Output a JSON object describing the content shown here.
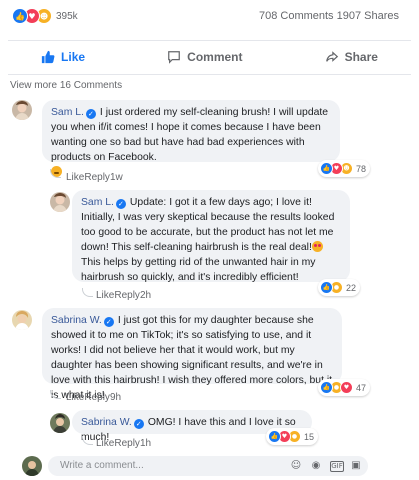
{
  "stats": {
    "reaction_count": "395k",
    "comments_shares": "708 Comments 1907 Shares",
    "reactions": [
      "like-icon",
      "love-icon",
      "haha-icon"
    ]
  },
  "actions": {
    "like": "Like",
    "comment": "Comment",
    "share": "Share"
  },
  "view_more": "View more 16 Comments",
  "comments": [
    {
      "author": "Sam L.",
      "text": "I just ordered my self-cleaning brush! I will update you when if/it comes! I hope it comes because I have been wanting one so bad but have had bad experiences with products on Facebook.",
      "reactions": "78",
      "like": "Like",
      "reply": "Reply",
      "time": "1w"
    },
    {
      "author": "Sam L.",
      "text_a": "Update: I got it a few days ago; I love it! Initially, I was very skeptical because the results looked too good to be accurate, but the product has not let me down! This self-cleaning hairbrush is the real deal!",
      "text_b": " This helps by getting rid of the unwanted hair in my hairbrush so quickly, and it's incredibly efficient!",
      "reactions": "22",
      "like": "Like",
      "reply": "Reply",
      "time": "2h"
    },
    {
      "author": "Sabrina W.",
      "text": "I just got this for my daughter because she showed it to me on TikTok; it's so satisfying to use, and it works! I did not believe her that it would work, but my daughter has been showing significant results, and we're in love with this hairbrush! I wish they offered more colors, but it is what it is!",
      "reactions": "47",
      "like": "Like",
      "reply": "Reply",
      "time": "9h"
    },
    {
      "author": "Sabrina W.",
      "text": "OMG! I have this and I love it so much!",
      "reactions": "15",
      "like": "Like",
      "reply": "Reply",
      "time": "1h"
    }
  ],
  "composer": {
    "placeholder": "Write a comment..."
  },
  "colors": {
    "brand": "#1877f2",
    "bubble": "#f0f2f5",
    "muted": "#65676b",
    "author": "#385898"
  }
}
